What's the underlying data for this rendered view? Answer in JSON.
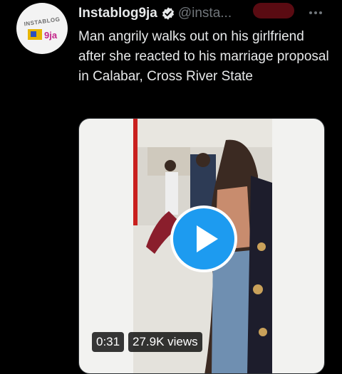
{
  "tweet": {
    "avatar_text": "INSTABLOG",
    "avatar_mark": "9ja",
    "display_name": "Instablog9ja",
    "handle": "@insta...",
    "text": "Man angrily walks out on his girlfriend after she reacted to his marriage proposal in Calabar, Cross River State"
  },
  "video": {
    "duration": "0:31",
    "views": "27.9K views"
  },
  "colors": {
    "background": "#000000",
    "accent": "#1d9bf0",
    "secondary_text": "#71767b"
  },
  "icons": {
    "verified": "verified-badge-icon",
    "more": "more-horizontal-icon",
    "play": "play-icon"
  }
}
